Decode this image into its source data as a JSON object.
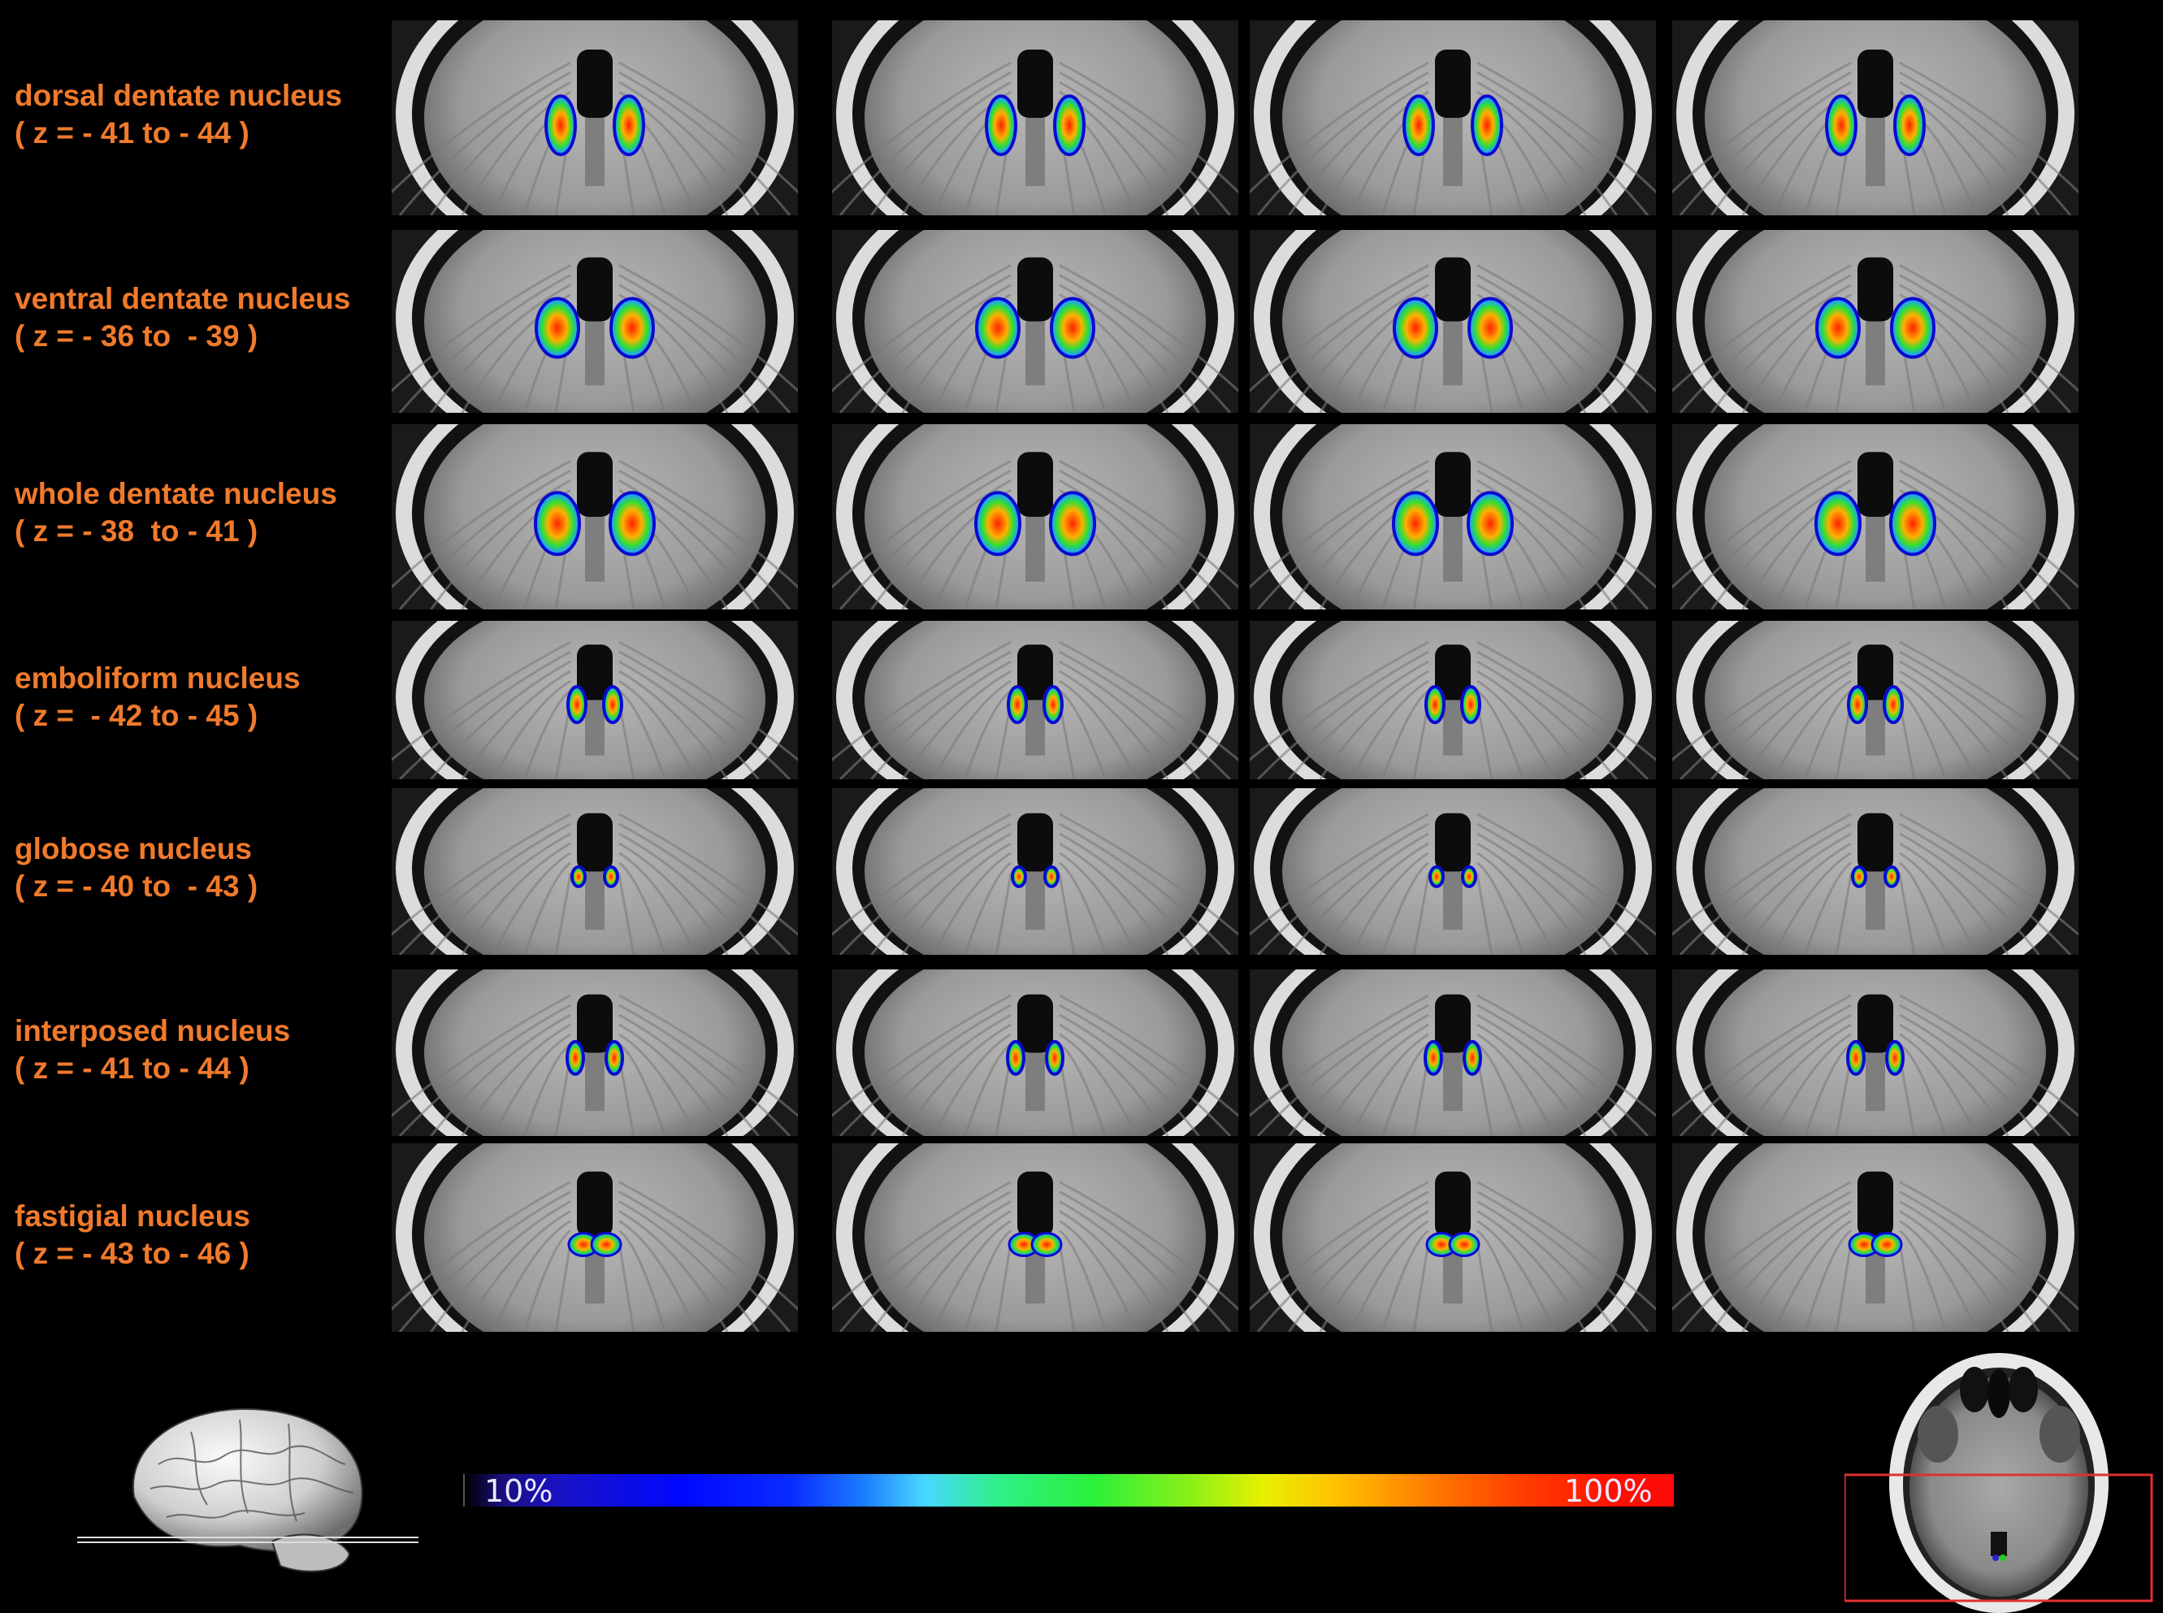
{
  "rows": [
    {
      "name": "dorsal dentate nucleus",
      "range": "( z = - 41 to - 44 )"
    },
    {
      "name": "ventral dentate nucleus",
      "range": "( z = - 36 to  - 39 )"
    },
    {
      "name": "whole dentate nucleus",
      "range": "( z = - 38  to - 41 )"
    },
    {
      "name": "emboliform nucleus",
      "range": "( z =  - 42 to - 45 )"
    },
    {
      "name": "globose nucleus",
      "range": "( z = - 40 to  - 43 )"
    },
    {
      "name": "interposed nucleus",
      "range": "( z = - 41 to - 44 )"
    },
    {
      "name": "fastigial nucleus",
      "range": "( z = - 43 to - 46 )"
    }
  ],
  "colorbar": {
    "min_label": "10%",
    "max_label": "100%"
  },
  "colors": {
    "label": "#f07a2c",
    "background": "#000000",
    "roi_box": "#e03030"
  }
}
